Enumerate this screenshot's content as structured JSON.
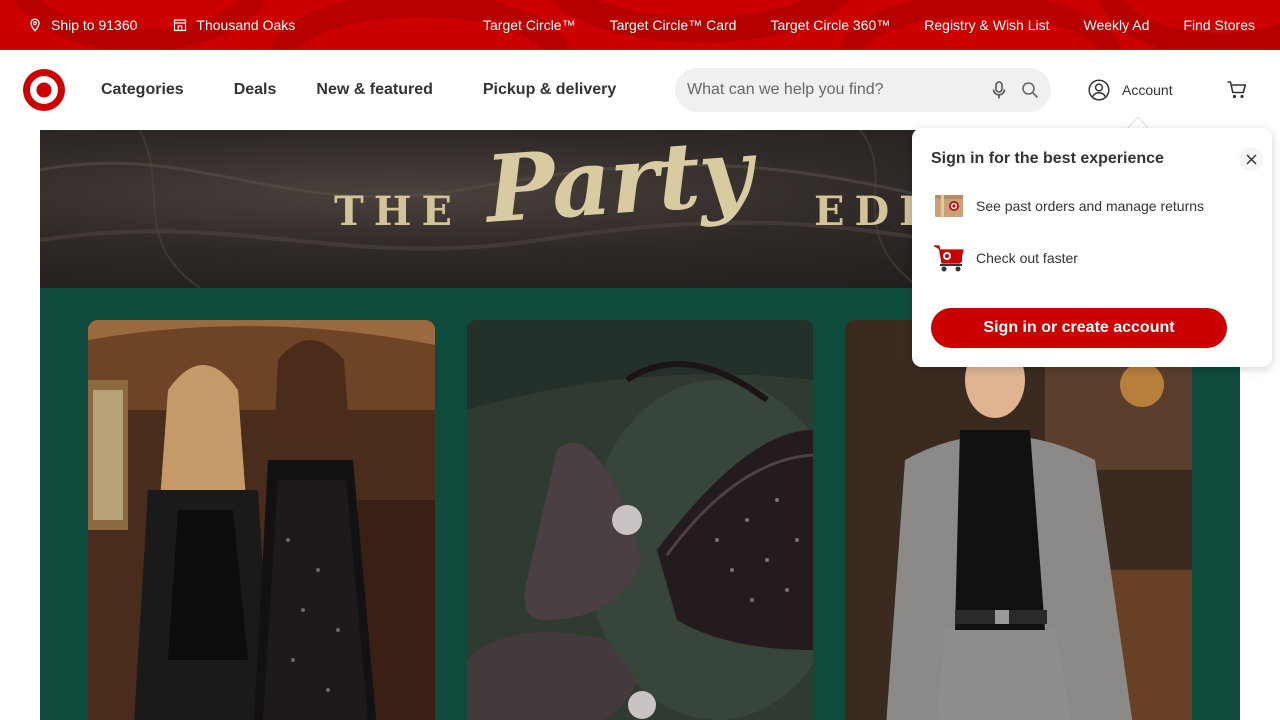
{
  "utility_bar": {
    "ship_to": "Ship to 91360",
    "store": "Thousand Oaks",
    "links": [
      {
        "label": "Target Circle™"
      },
      {
        "label": "Target Circle™ Card"
      },
      {
        "label": "Target Circle 360™"
      },
      {
        "label": "Registry & Wish List"
      },
      {
        "label": "Weekly Ad"
      },
      {
        "label": "Find Stores"
      }
    ]
  },
  "header": {
    "nav": [
      {
        "label": "Categories"
      },
      {
        "label": "Deals"
      },
      {
        "label": "New & featured"
      },
      {
        "label": "Pickup & delivery"
      }
    ],
    "search": {
      "placeholder": "What can we help you find?"
    },
    "account_label": "Account"
  },
  "hero": {
    "word_1": "THE",
    "word_2": "Party",
    "word_3": "EDI"
  },
  "flyout": {
    "title": "Sign in for the best experience",
    "benefits": [
      {
        "icon": "package-icon",
        "text": "See past orders and manage returns"
      },
      {
        "icon": "cart-icon",
        "text": "Check out faster"
      }
    ],
    "button_label": "Sign in or create account"
  },
  "colors": {
    "brand_red": "#cc0000",
    "section_green": "#0f4b3c",
    "text_dark": "#333333"
  }
}
